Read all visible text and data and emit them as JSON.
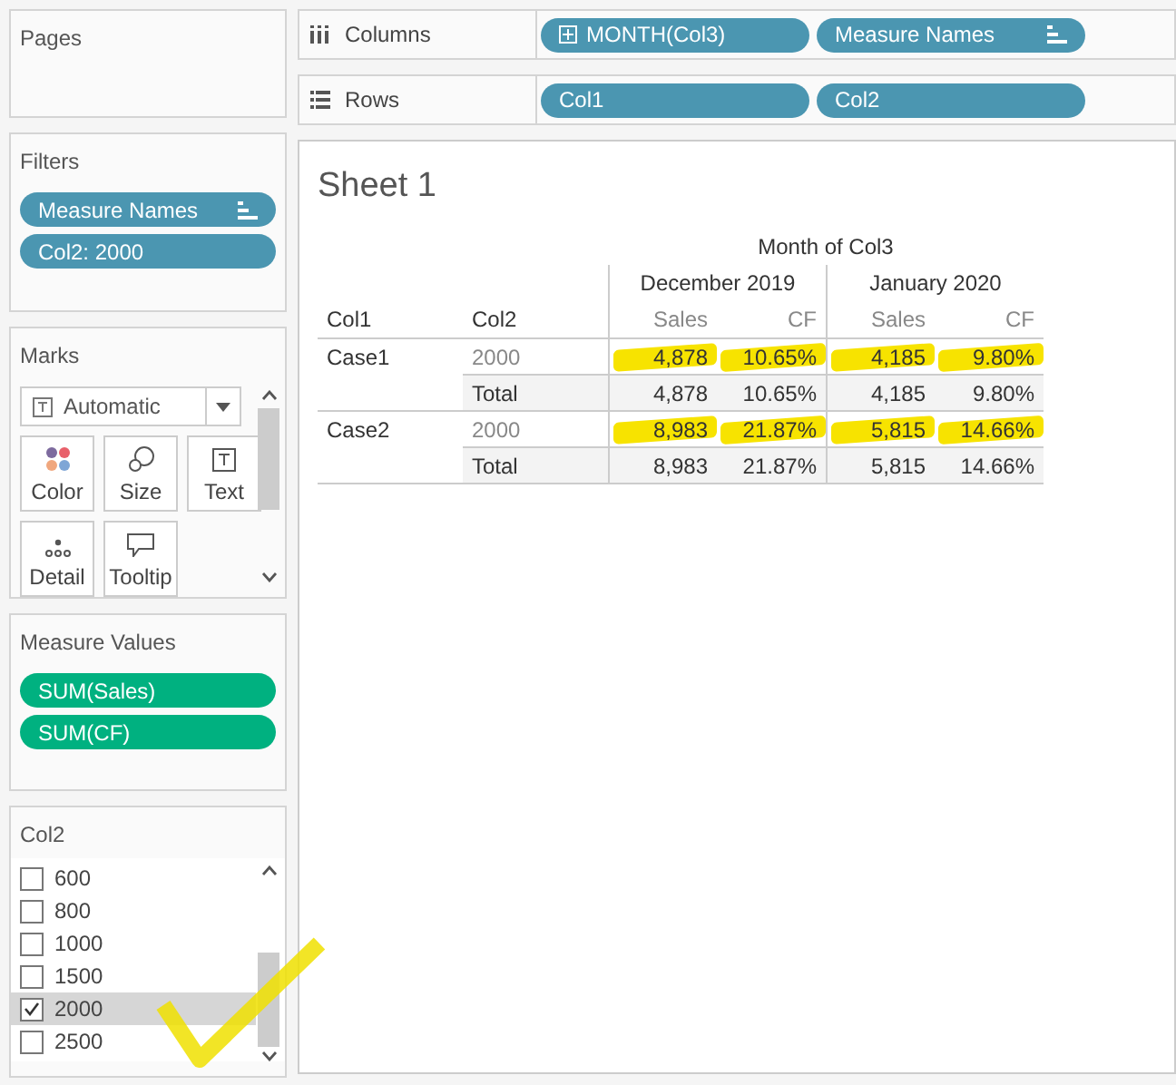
{
  "columns_shelf": {
    "label": "Columns",
    "pills": [
      {
        "text": "MONTH(Col3)",
        "kind": "expandable"
      },
      {
        "text": "Measure Names",
        "kind": "sorted"
      }
    ]
  },
  "rows_shelf": {
    "label": "Rows",
    "pills": [
      {
        "text": "Col1"
      },
      {
        "text": "Col2"
      }
    ]
  },
  "pages": {
    "title": "Pages"
  },
  "filters": {
    "title": "Filters",
    "pills": [
      {
        "text": "Measure Names",
        "kind": "sorted"
      },
      {
        "text": "Col2: 2000"
      }
    ]
  },
  "marks": {
    "title": "Marks",
    "mark_type": "Automatic",
    "buttons": [
      {
        "label": "Color",
        "kind": "color"
      },
      {
        "label": "Size",
        "kind": "size"
      },
      {
        "label": "Text",
        "kind": "text"
      },
      {
        "label": "Detail",
        "kind": "detail"
      },
      {
        "label": "Tooltip",
        "kind": "tooltip"
      }
    ]
  },
  "measure_values": {
    "title": "Measure Values",
    "pills": [
      "SUM(Sales)",
      "SUM(CF)"
    ]
  },
  "col2_filter": {
    "title": "Col2",
    "items": [
      {
        "label": "600",
        "checked": false,
        "selected": false
      },
      {
        "label": "800",
        "checked": false,
        "selected": false
      },
      {
        "label": "1000",
        "checked": false,
        "selected": false
      },
      {
        "label": "1500",
        "checked": false,
        "selected": false
      },
      {
        "label": "2000",
        "checked": true,
        "selected": true
      },
      {
        "label": "2500",
        "checked": false,
        "selected": false
      }
    ]
  },
  "sheet": {
    "title": "Sheet 1",
    "column_header": "Month of Col3",
    "row_headers": [
      "Col1",
      "Col2"
    ],
    "months": [
      {
        "label": "December 2019",
        "measures": [
          "Sales",
          "CF"
        ]
      },
      {
        "label": "January 2020",
        "measures": [
          "Sales",
          "CF"
        ]
      }
    ],
    "rows": [
      {
        "kind": "detail",
        "col1": "Case1",
        "col2": "2000",
        "cells": [
          {
            "text": "4,878",
            "highlighted": true
          },
          {
            "text": "10.65%",
            "highlighted": true
          },
          {
            "text": "4,185",
            "highlighted": true
          },
          {
            "text": "9.80%",
            "highlighted": true
          }
        ]
      },
      {
        "kind": "total",
        "col2": "Total",
        "cells": [
          {
            "text": "4,878",
            "highlighted": false
          },
          {
            "text": "10.65%",
            "highlighted": false
          },
          {
            "text": "4,185",
            "highlighted": false
          },
          {
            "text": "9.80%",
            "highlighted": false
          }
        ]
      },
      {
        "kind": "detail",
        "col1": "Case2",
        "col2": "2000",
        "cells": [
          {
            "text": "8,983",
            "highlighted": true
          },
          {
            "text": "21.87%",
            "highlighted": true
          },
          {
            "text": "5,815",
            "highlighted": true
          },
          {
            "text": "14.66%",
            "highlighted": true
          }
        ]
      },
      {
        "kind": "total",
        "col2": "Total",
        "cells": [
          {
            "text": "8,983",
            "highlighted": false
          },
          {
            "text": "21.87%",
            "highlighted": false
          },
          {
            "text": "5,815",
            "highlighted": false
          },
          {
            "text": "14.66%",
            "highlighted": false
          }
        ]
      }
    ]
  }
}
